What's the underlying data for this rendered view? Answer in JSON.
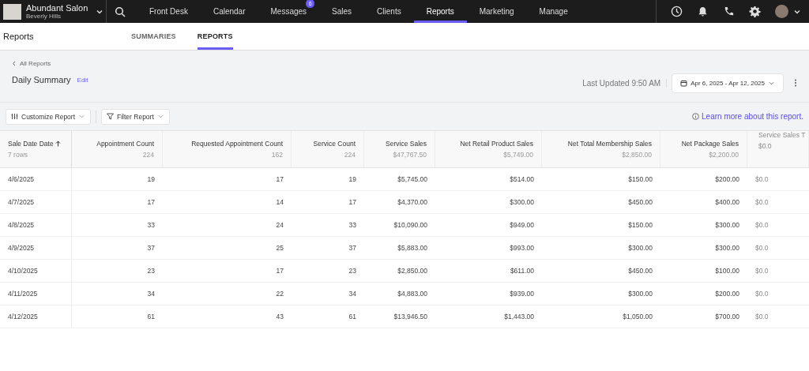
{
  "business": {
    "name": "Abundant Salon",
    "location": "Beverly Hills"
  },
  "nav": [
    {
      "label": "Front Desk",
      "selected": false
    },
    {
      "label": "Calendar",
      "selected": false
    },
    {
      "label": "Messages",
      "selected": false,
      "badge": "6"
    },
    {
      "label": "Sales",
      "selected": false
    },
    {
      "label": "Clients",
      "selected": false
    },
    {
      "label": "Reports",
      "selected": true
    },
    {
      "label": "Marketing",
      "selected": false
    },
    {
      "label": "Manage",
      "selected": false
    }
  ],
  "page_title": "Reports",
  "tabs": [
    {
      "label": "SUMMARIES",
      "selected": false
    },
    {
      "label": "REPORTS",
      "selected": true
    }
  ],
  "back_link": "All Reports",
  "report_title": "Daily Summary",
  "edit_link": "Edit",
  "last_updated": "Last Updated 9:50 AM",
  "date_range": "Apr 6, 2025 - Apr 12, 2025",
  "toolbar": {
    "customize": "Customize Report",
    "filter": "Filter Report",
    "learn_more": "Learn more about this report."
  },
  "table": {
    "columns": [
      {
        "label": "Sale Date Date",
        "total": "7 rows",
        "sorted": true
      },
      {
        "label": "Appointment Count",
        "total": "224",
        "sorted": false
      },
      {
        "label": "Requested Appointment Count",
        "total": "162",
        "sorted": false
      },
      {
        "label": "Service Count",
        "total": "224",
        "sorted": false
      },
      {
        "label": "Service Sales",
        "total": "$47,767.50",
        "sorted": false
      },
      {
        "label": "Net Retail Product Sales",
        "total": "$5,749.00",
        "sorted": false
      },
      {
        "label": "Net Total Membership Sales",
        "total": "$2,850.00",
        "sorted": false
      },
      {
        "label": "Net Package Sales",
        "total": "$2,200.00",
        "sorted": false
      },
      {
        "label": "Service Sales T",
        "total": "$0.0",
        "sorted": false
      }
    ],
    "rows": [
      [
        "4/6/2025",
        "19",
        "17",
        "19",
        "$5,745.00",
        "$514.00",
        "$150.00",
        "$200.00",
        "$0.0"
      ],
      [
        "4/7/2025",
        "17",
        "14",
        "17",
        "$4,370.00",
        "$300.00",
        "$450.00",
        "$400.00",
        "$0.0"
      ],
      [
        "4/8/2025",
        "33",
        "24",
        "33",
        "$10,090.00",
        "$949.00",
        "$150.00",
        "$300.00",
        "$0.0"
      ],
      [
        "4/9/2025",
        "37",
        "25",
        "37",
        "$5,883.00",
        "$993.00",
        "$300.00",
        "$300.00",
        "$0.0"
      ],
      [
        "4/10/2025",
        "23",
        "17",
        "23",
        "$2,850.00",
        "$611.00",
        "$450.00",
        "$100.00",
        "$0.0"
      ],
      [
        "4/11/2025",
        "34",
        "22",
        "34",
        "$4,883.00",
        "$939.00",
        "$300.00",
        "$200.00",
        "$0.0"
      ],
      [
        "4/12/2025",
        "61",
        "43",
        "61",
        "$13,946.50",
        "$1,443.00",
        "$1,050.00",
        "$700.00",
        "$0.0"
      ]
    ]
  }
}
